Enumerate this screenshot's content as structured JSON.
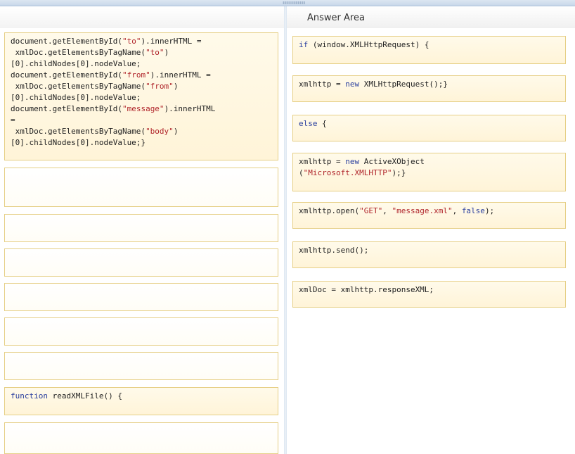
{
  "answer_area": {
    "title": "Answer Area"
  },
  "source": {
    "code1": {
      "line1a": "document.getElementById(",
      "line1s": "\"to\"",
      "line1b": ").innerHTML =",
      "line2a": " xmlDoc.getElementsByTagName(",
      "line2s": "\"to\"",
      "line2b": ")",
      "line3": "[0].childNodes[0].nodeValue;",
      "line4a": "document.getElementById(",
      "line4s": "\"from\"",
      "line4b": ").innerHTML =",
      "line5a": " xmlDoc.getElementsByTagName(",
      "line5s": "\"from\"",
      "line5b": ")",
      "line6": "[0].childNodes[0].nodeValue;",
      "line7a": "document.getElementById(",
      "line7s": "\"message\"",
      "line7b": ").innerHTML",
      "line8": "=",
      "line9a": " xmlDoc.getElementsByTagName(",
      "line9s": "\"body\"",
      "line9b": ")",
      "line10": "[0].childNodes[0].nodeValue;}"
    },
    "code2": {
      "kw": "function",
      "rest": " readXMLFile() {"
    }
  },
  "answer": {
    "a1": {
      "kw": "if",
      "rest": " (window.XMLHttpRequest) {"
    },
    "a2": {
      "pre": "xmlhttp = ",
      "kw": "new",
      "rest": " XMLHttpRequest();}"
    },
    "a3": {
      "kw": "else",
      "rest": " {"
    },
    "a4": {
      "pre": "xmlhttp = ",
      "kw": "new",
      "rest": " ActiveXObject",
      "line2a": "(",
      "str": "\"Microsoft.XMLHTTP\"",
      "line2b": ");}"
    },
    "a5": {
      "pre": "xmlhttp.open(",
      "s1": "\"GET\"",
      "c1": ", ",
      "s2": "\"message.xml\"",
      "c2": ", ",
      "kw": "false",
      "post": ");"
    },
    "a6": {
      "text": "xmlhttp.send();"
    },
    "a7": {
      "text": "xmlDoc = xmlhttp.responseXML;"
    }
  }
}
